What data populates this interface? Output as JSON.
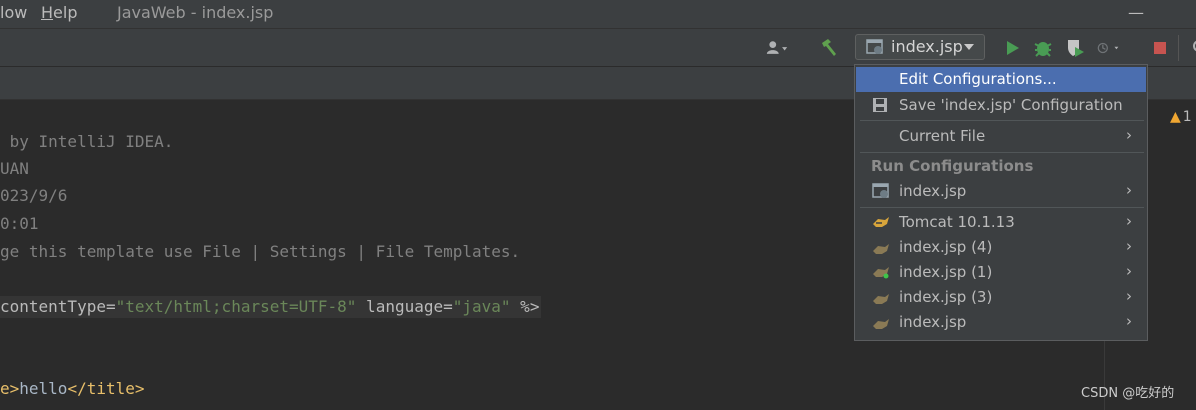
{
  "menubar": {
    "items": [
      {
        "prefix": "",
        "underline": "",
        "rest": "low"
      },
      {
        "prefix": "",
        "underline": "H",
        "rest": "elp"
      }
    ],
    "window_title": "JavaWeb - index.jsp",
    "minimize_glyph": "—"
  },
  "toolbar": {
    "user_icon": "user-icon",
    "build_icon": "hammer-icon",
    "run_config_label": "index.jsp",
    "run_icon": "run-icon",
    "debug_icon": "debug-icon",
    "coverage_icon": "coverage-icon",
    "profile_icon": "profile-icon",
    "stop_icon": "stop-icon",
    "colors": {
      "run": "#499c54",
      "stop": "#c75450",
      "build": "#5fa04e"
    }
  },
  "editor": {
    "lines": [
      {
        "text": " by IntelliJ IDEA."
      },
      {
        "text": "UAN"
      },
      {
        "text": "023/9/6"
      },
      {
        "text": "0:01"
      },
      {
        "text": "ge this template use File | Settings | File Templates."
      },
      {
        "parts": [
          "contentType=",
          "\"text/html;charset=UTF-8\"",
          " language=",
          "\"java\"",
          " %>"
        ]
      },
      {
        "parts": [
          "e>",
          "hello",
          "</title>"
        ]
      }
    ],
    "warning_count": "1"
  },
  "popup": {
    "edit_configurations": "Edit Configurations...",
    "save_configuration": "Save 'index.jsp' Configuration",
    "current_file": "Current File",
    "run_configurations_header": "Run Configurations",
    "run_configs": [
      {
        "label": "index.jsp",
        "icon": "jsp-config-icon"
      },
      {
        "label": "Tomcat 10.1.13",
        "icon": "tomcat-icon"
      },
      {
        "label": "index.jsp (4)",
        "icon": "tomcat-icon"
      },
      {
        "label": "index.jsp (1)",
        "icon": "tomcat-running-icon"
      },
      {
        "label": "index.jsp (3)",
        "icon": "tomcat-icon"
      },
      {
        "label": "index.jsp",
        "icon": "tomcat-icon"
      }
    ],
    "arrow": "›"
  },
  "watermark": "CSDN @吃好的"
}
